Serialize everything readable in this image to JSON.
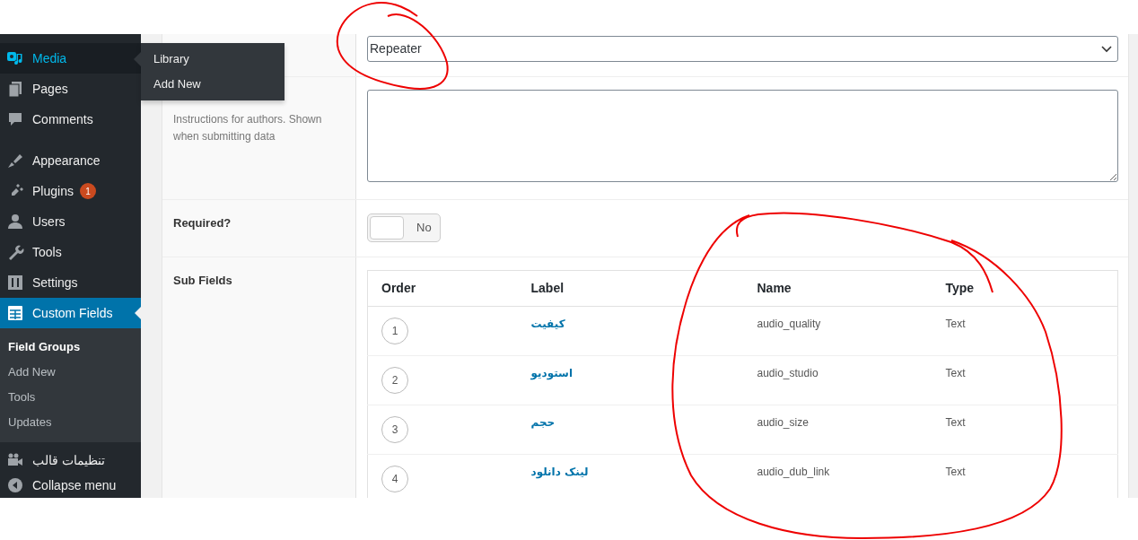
{
  "sidebar": {
    "groups": [
      [
        {
          "label": "Media",
          "hovered": true,
          "current": false
        },
        {
          "label": "Pages",
          "hovered": false,
          "current": false
        },
        {
          "label": "Comments",
          "hovered": false,
          "current": false
        }
      ],
      [
        {
          "label": "Appearance",
          "hovered": false,
          "current": false
        },
        {
          "label": "Plugins",
          "hovered": false,
          "current": false,
          "badge": "1"
        },
        {
          "label": "Users",
          "hovered": false,
          "current": false
        },
        {
          "label": "Tools",
          "hovered": false,
          "current": false
        },
        {
          "label": "Settings",
          "hovered": false,
          "current": false
        },
        {
          "label": "Custom Fields",
          "hovered": false,
          "current": true,
          "submenu": [
            {
              "label": "Field Groups",
              "current": true
            },
            {
              "label": "Add New",
              "current": false
            },
            {
              "label": "Tools",
              "current": false
            },
            {
              "label": "Updates",
              "current": false
            }
          ]
        }
      ],
      [
        {
          "label": "تنظیمات قالب",
          "hovered": false,
          "current": false
        },
        {
          "label": "Collapse menu",
          "hovered": false,
          "current": false
        }
      ]
    ]
  },
  "flyout": {
    "items": [
      "Library",
      "Add New"
    ]
  },
  "field_type": {
    "value": "Repeater"
  },
  "instructions": {
    "description": "Instructions for authors. Shown when submitting data"
  },
  "required": {
    "label": "Required?",
    "on": false,
    "text": "No"
  },
  "sub_fields": {
    "label": "Sub Fields",
    "table": {
      "columns": [
        "Order",
        "Label",
        "Name",
        "Type"
      ],
      "rows": [
        {
          "order": "1",
          "label": "کیفیت",
          "name": "audio_quality",
          "type": "Text"
        },
        {
          "order": "2",
          "label": "استودیو",
          "name": "audio_studio",
          "type": "Text"
        },
        {
          "order": "3",
          "label": "حجم",
          "name": "audio_size",
          "type": "Text"
        },
        {
          "order": "4",
          "label": "لینک دانلود",
          "name": "audio_dub_link",
          "type": "Text"
        }
      ]
    }
  }
}
